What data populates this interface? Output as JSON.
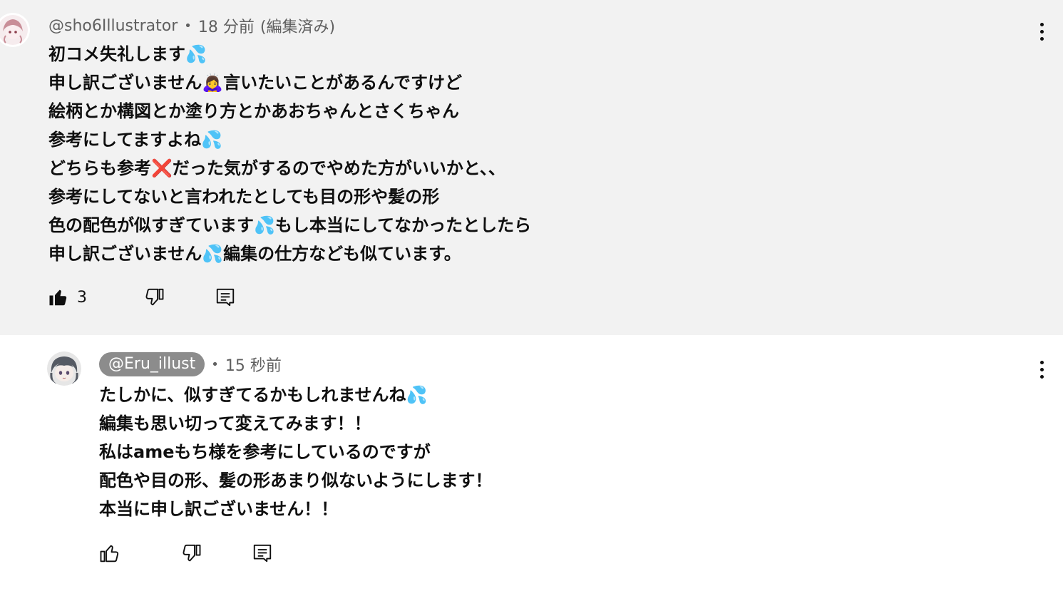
{
  "comments": [
    {
      "author": "@sho6Illustrator",
      "time": "18 分前",
      "edited": "(編集済み)",
      "lines": [
        "初コメ失礼します💦",
        "申し訳ございません🙇‍♀️言いたいことがあるんですけど",
        "絵柄とか構図とか塗り方とかあおちゃんとさくちゃん",
        "参考にしてますよね💦",
        "どちらも参考❌だった気がするのでやめた方がいいかと、、",
        "参考にしてないと言われたとしても目の形や髪の形",
        "色の配色が似すぎています💦もし本当にしてなかったとしたら",
        "申し訳ございません💦編集の仕方なども似ています。"
      ],
      "like_count": "3",
      "like_filled": true
    },
    {
      "author": "@Eru_illust",
      "time": "15 秒前",
      "lines": [
        "たしかに、似すぎてるかもしれませんね💦",
        "編集も思い切って変えてみます！！",
        "私はameもち様を参考にしているのですが",
        "配色や目の形、髪の形あまり似ないようにします！",
        "本当に申し訳ございません！！"
      ],
      "like_count": "",
      "like_filled": false
    }
  ],
  "icons": {
    "like": "thumbs-up-icon",
    "dislike": "thumbs-down-icon",
    "reply": "reply-icon",
    "menu": "more-vertical-icon"
  },
  "colors": {
    "highlight_bg": "#f2f2f2",
    "text": "#0f0f0f",
    "meta": "#606060",
    "author_chip": "#8c8c8c"
  }
}
